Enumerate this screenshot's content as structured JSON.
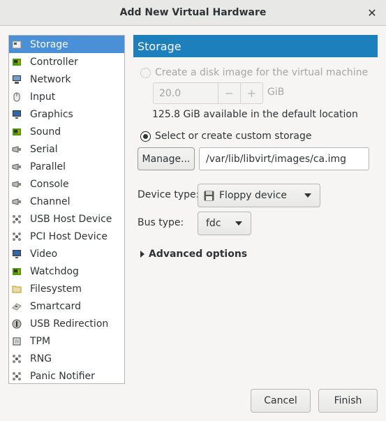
{
  "window": {
    "title": "Add New Virtual Hardware",
    "close_glyph": "✕"
  },
  "devices": [
    {
      "label": "Storage",
      "icon": "storage-icon"
    },
    {
      "label": "Controller",
      "icon": "controller-icon"
    },
    {
      "label": "Network",
      "icon": "network-icon"
    },
    {
      "label": "Input",
      "icon": "mouse-icon"
    },
    {
      "label": "Graphics",
      "icon": "graphics-icon"
    },
    {
      "label": "Sound",
      "icon": "sound-icon"
    },
    {
      "label": "Serial",
      "icon": "serial-icon"
    },
    {
      "label": "Parallel",
      "icon": "parallel-icon"
    },
    {
      "label": "Console",
      "icon": "console-icon"
    },
    {
      "label": "Channel",
      "icon": "channel-icon"
    },
    {
      "label": "USB Host Device",
      "icon": "usb-icon"
    },
    {
      "label": "PCI Host Device",
      "icon": "pci-icon"
    },
    {
      "label": "Video",
      "icon": "video-icon"
    },
    {
      "label": "Watchdog",
      "icon": "watchdog-icon"
    },
    {
      "label": "Filesystem",
      "icon": "folder-icon"
    },
    {
      "label": "Smartcard",
      "icon": "smartcard-icon"
    },
    {
      "label": "USB Redirection",
      "icon": "usb-redirection-icon"
    },
    {
      "label": "TPM",
      "icon": "tpm-icon"
    },
    {
      "label": "RNG",
      "icon": "rng-icon"
    },
    {
      "label": "Panic Notifier",
      "icon": "panic-icon"
    }
  ],
  "selected_device": "Storage",
  "panel": {
    "title": "Storage",
    "create_disk_label": "Create a disk image for the virtual machine",
    "size_value": "20.0",
    "size_minus": "−",
    "size_plus": "+",
    "size_unit": "GiB",
    "available_text": "125.8 GiB available in the default location",
    "custom_storage_label": "Select or create custom storage",
    "manage_button": "Manage...",
    "path_value": "/var/lib/libvirt/images/ca.img",
    "device_type_label": "Device type:",
    "device_type_value": "Floppy device",
    "bus_type_label": "Bus type:",
    "bus_type_value": "fdc",
    "advanced_label": "Advanced options"
  },
  "footer": {
    "cancel": "Cancel",
    "finish": "Finish"
  },
  "colors": {
    "accent": "#1e7fbd",
    "selection": "#4a90d9"
  }
}
